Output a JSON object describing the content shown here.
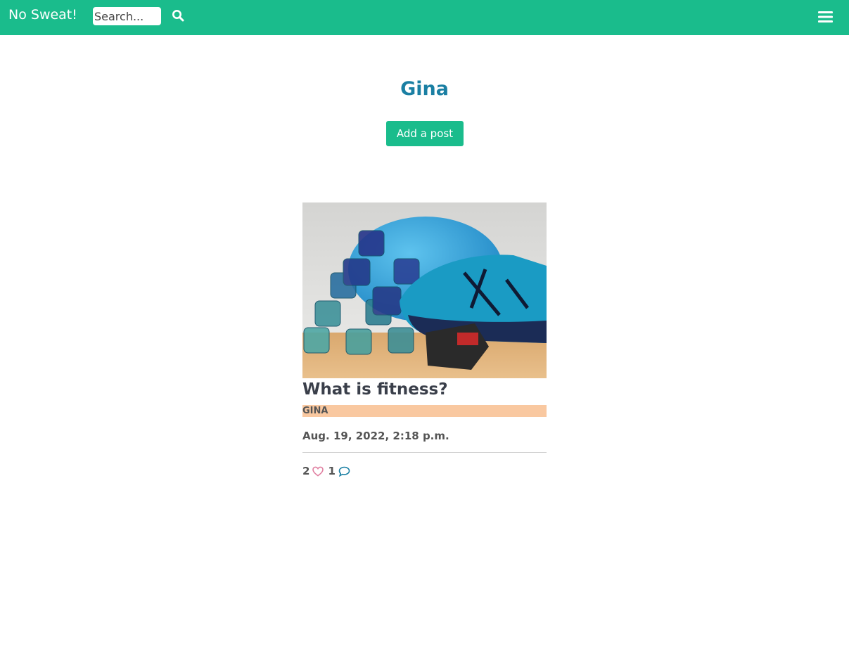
{
  "navbar": {
    "brand": "No Sweat!",
    "search_placeholder": "Search...",
    "search_icon": "search-icon",
    "menu_icon": "hamburger-menu-icon",
    "color": "#1abc8c"
  },
  "profile": {
    "name": "Gina",
    "add_post_label": "Add a post"
  },
  "posts": [
    {
      "title": "What is fitness?",
      "author": "Gina",
      "date": "Aug. 19, 2022, 2:18 p.m.",
      "likes": "2",
      "comments": "1",
      "image": "dumbbells-and-running-shoe-photo",
      "like_icon": "heart-icon",
      "comment_icon": "comment-icon"
    }
  ],
  "colors": {
    "accent": "#1abc8c",
    "title": "#1a7fa3",
    "author_bar": "#f9c8a0",
    "heart": "#e07fa0",
    "comment": "#1a7fa3"
  }
}
